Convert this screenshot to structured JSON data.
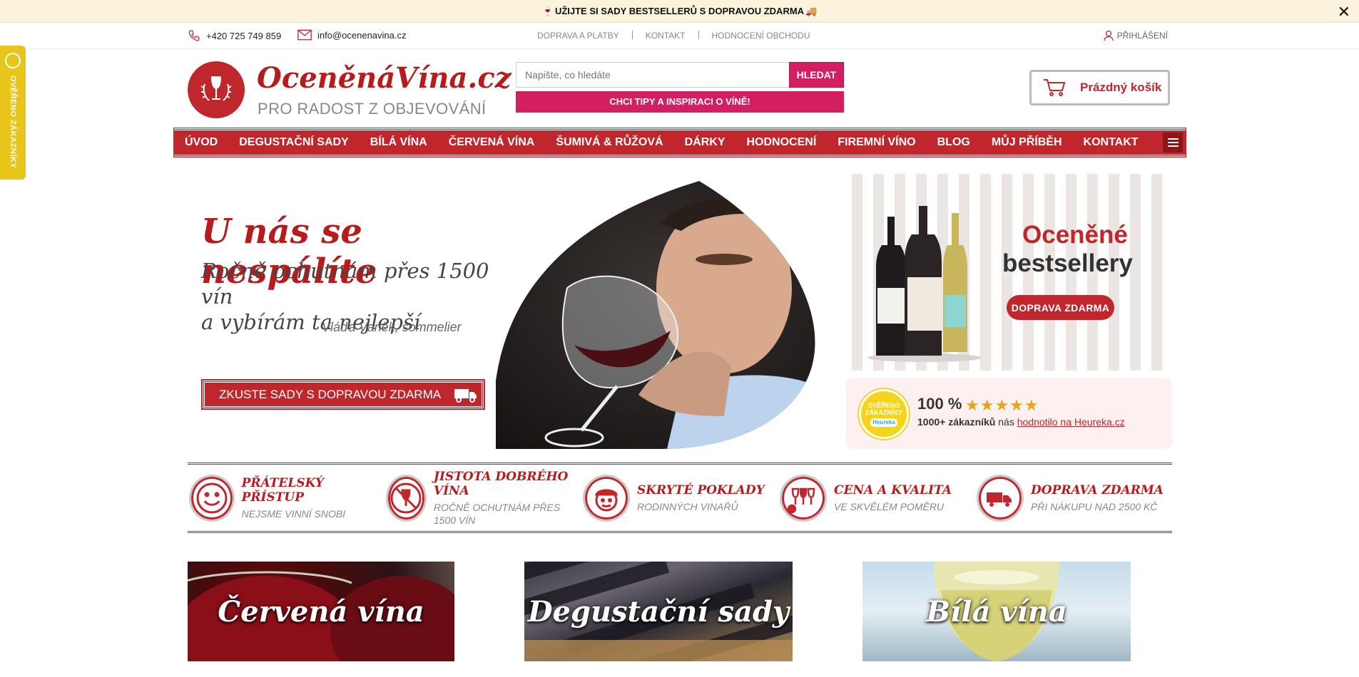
{
  "announcement": {
    "text": "UŽIJTE SI SADY BESTSELLERŮ S DOPRAVOU ZDARMA",
    "close_label": "✕"
  },
  "contact": {
    "phone": "+420 725 749 859",
    "email": "info@ocenenavina.cz"
  },
  "top_nav": {
    "items": [
      "DOPRAVA A PLATBY",
      "KONTAKT",
      "HODNOCENÍ OBCHODU"
    ],
    "login": "PŘIHLÁŠENÍ"
  },
  "side_badge": {
    "label": "OVĚŘENO ZÁKAZNÍKY"
  },
  "header": {
    "brand": "OceněnáVína.cz",
    "tagline": "PRO RADOST Z OBJEVOVÁNÍ",
    "search_placeholder": "Napište, co hledáte",
    "search_button": "HLEDAT",
    "tips_button": "CHCI TIPY A INSPIRACI O VÍNĚ!",
    "cart_label": "Prázdný košík"
  },
  "menu": {
    "items": [
      "ÚVOD",
      "DEGUSTAČNÍ SADY",
      "BÍLÁ VÍNA",
      "ČERVENÁ VÍNA",
      "ŠUMIVÁ & RŮŽOVÁ",
      "DÁRKY",
      "HODNOCENÍ",
      "FIREMNÍ VÍNO",
      "BLOG",
      "MŮJ PŘÍBĚH",
      "KONTAKT"
    ]
  },
  "hero": {
    "title": "U nás se nespálíte",
    "subtitle_1": "Ročně ochutnám přes 1500 vín",
    "subtitle_2": "a vybírám ta nejlepší",
    "signature": "Vláďa Vaněk, sommelier",
    "button": "ZKUSTE SADY S DOPRAVOU ZDARMA"
  },
  "bestsellers": {
    "title_1": "Oceněné",
    "title_2": "bestsellery",
    "button": "DOPRAVA ZDARMA"
  },
  "heureka": {
    "seal_text_1": "OVĚŘENO",
    "seal_text_2": "ZÁKAZNÍKY",
    "seal_brand": "Heureka",
    "percent": "100 %",
    "stars": "★★★★★",
    "customers": "1000+ zákazníků",
    "mid": "nás",
    "link": "hodnotilo na Heureka.cz"
  },
  "usps": [
    {
      "title": "PŘÁTELSKÝ PŘÍSTUP",
      "sub": "NEJSME VINNÍ SNOBI"
    },
    {
      "title": "JISTOTA DOBRÉHO VÍNA",
      "sub": "ROČNĚ OCHUTNÁM PŘES 1500 VÍN"
    },
    {
      "title": "SKRYTÉ POKLADY",
      "sub": "RODINNÝCH VINAŘŮ"
    },
    {
      "title": "CENA A KVALITA",
      "sub": "VE SKVĚLÉM POMĚRU"
    },
    {
      "title": "DOPRAVA ZDARMA",
      "sub": "PŘI NÁKUPU NAD 2500 KČ"
    }
  ],
  "categories": [
    "Červená vína",
    "Degustační sady",
    "Bílá vína"
  ],
  "colors": {
    "accent": "#c0272d",
    "pink": "#d31f62",
    "gold": "#e8c51a",
    "banner_bg": "#fbf3dc"
  }
}
